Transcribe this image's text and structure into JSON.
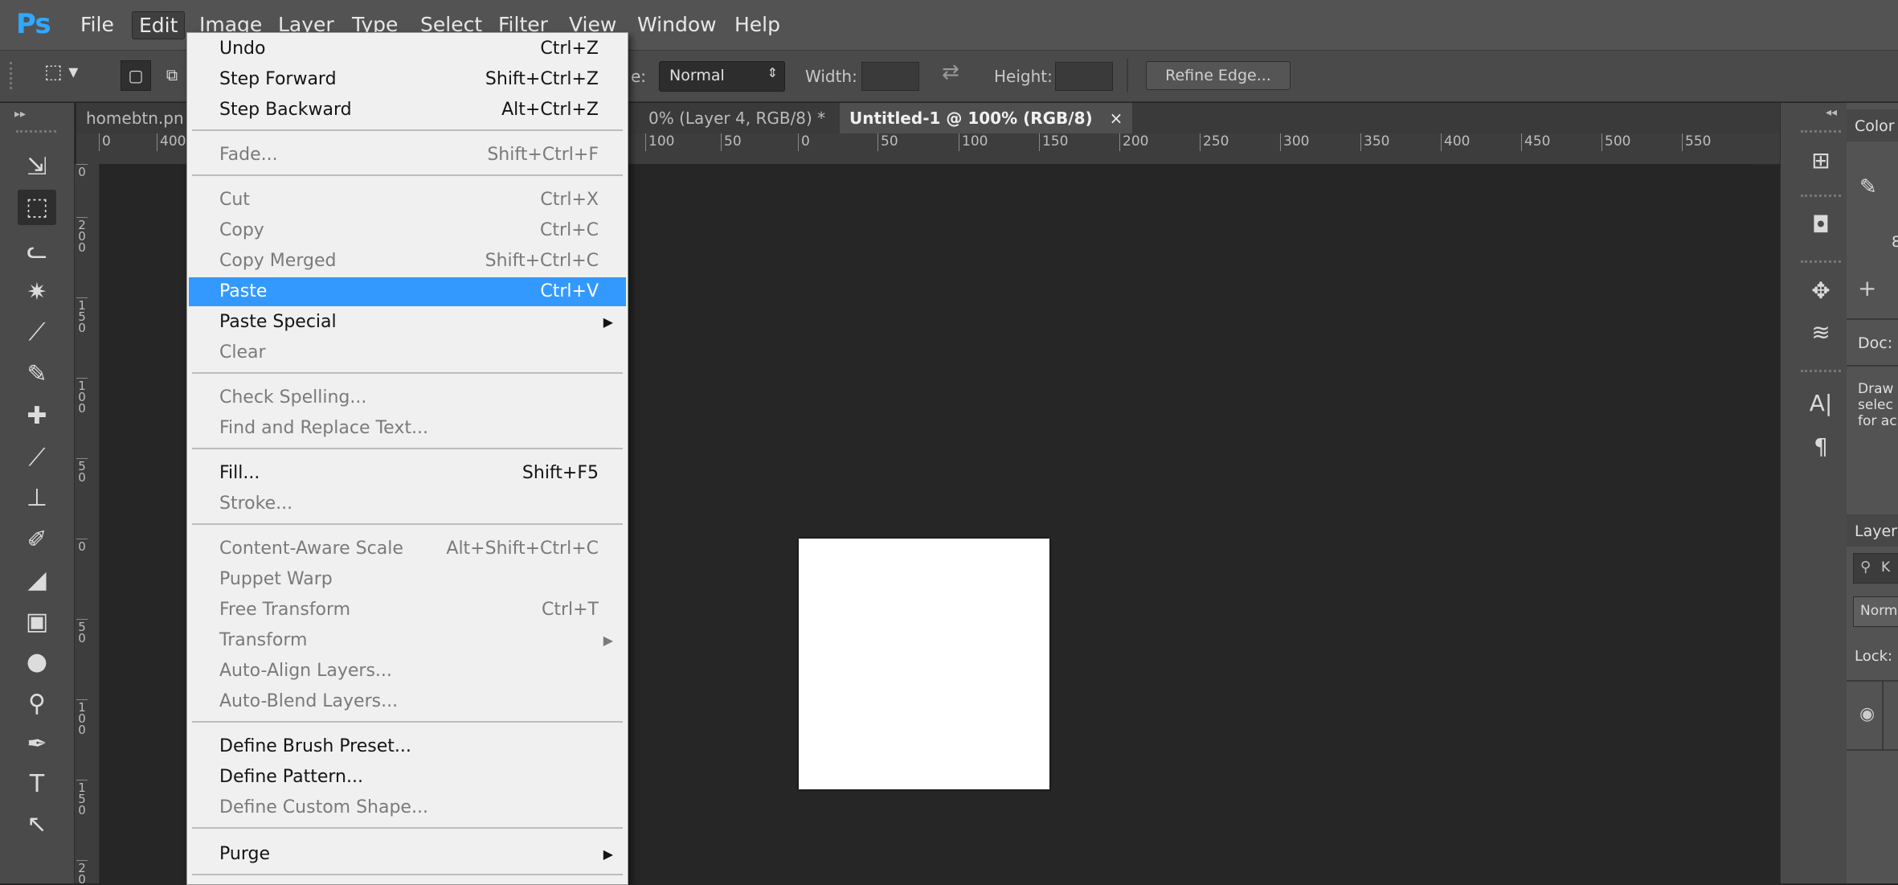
{
  "app": {
    "logo": "Ps"
  },
  "menubar": {
    "items": [
      {
        "label": "File"
      },
      {
        "label": "Edit"
      },
      {
        "label": "Image"
      },
      {
        "label": "Layer"
      },
      {
        "label": "Type"
      },
      {
        "label": "Select"
      },
      {
        "label": "Filter"
      },
      {
        "label": "View"
      },
      {
        "label": "Window"
      },
      {
        "label": "Help"
      }
    ]
  },
  "options": {
    "style_label": "e:",
    "style_value": "Normal",
    "width_label": "Width:",
    "height_label": "Height:",
    "refine_edge": "Refine Edge..."
  },
  "tabs": [
    {
      "label": "homebtn.pn"
    },
    {
      "label": "0% (Layer 4, RGB/8) *",
      "close": "×"
    },
    {
      "label": "Untitled-1 @ 100% (RGB/8)",
      "close": "×"
    }
  ],
  "ruler_h": {
    "left_labels": [
      "0",
      "400"
    ],
    "right_labels": [
      "100",
      "50",
      "0",
      "50",
      "100",
      "150",
      "200",
      "250",
      "300",
      "350",
      "400",
      "450",
      "500",
      "550"
    ]
  },
  "ruler_v": [
    "0",
    "2 0 0",
    "1 5 0",
    "1 0 0",
    "5 0",
    "0",
    "5 0",
    "1 0 0",
    "1 5 0",
    "2 0"
  ],
  "right_panel": {
    "color": "Color",
    "eight": "8",
    "doc": "Doc:",
    "hint_lines": [
      "Draw",
      "selec",
      "for ac"
    ],
    "layers": "Layers",
    "search": "K",
    "blend": "Norm",
    "lock": "Lock:"
  },
  "edit_menu": {
    "groups": [
      [
        {
          "label": "Undo",
          "shortcut": "Ctrl+Z",
          "enabled": true
        },
        {
          "label": "Step Forward",
          "shortcut": "Shift+Ctrl+Z",
          "enabled": true
        },
        {
          "label": "Step Backward",
          "shortcut": "Alt+Ctrl+Z",
          "enabled": true
        }
      ],
      [
        {
          "label": "Fade...",
          "shortcut": "Shift+Ctrl+F",
          "enabled": false
        }
      ],
      [
        {
          "label": "Cut",
          "shortcut": "Ctrl+X",
          "enabled": false
        },
        {
          "label": "Copy",
          "shortcut": "Ctrl+C",
          "enabled": false
        },
        {
          "label": "Copy Merged",
          "shortcut": "Shift+Ctrl+C",
          "enabled": false
        },
        {
          "label": "Paste",
          "shortcut": "Ctrl+V",
          "enabled": true,
          "highlight": true
        },
        {
          "label": "Paste Special",
          "shortcut": "",
          "enabled": true,
          "submenu": true
        },
        {
          "label": "Clear",
          "shortcut": "",
          "enabled": false
        }
      ],
      [
        {
          "label": "Check Spelling...",
          "shortcut": "",
          "enabled": false
        },
        {
          "label": "Find and Replace Text...",
          "shortcut": "",
          "enabled": false
        }
      ],
      [
        {
          "label": "Fill...",
          "shortcut": "Shift+F5",
          "enabled": true
        },
        {
          "label": "Stroke...",
          "shortcut": "",
          "enabled": false
        }
      ],
      [
        {
          "label": "Content-Aware Scale",
          "shortcut": "Alt+Shift+Ctrl+C",
          "enabled": false
        },
        {
          "label": "Puppet Warp",
          "shortcut": "",
          "enabled": false
        },
        {
          "label": "Free Transform",
          "shortcut": "Ctrl+T",
          "enabled": false
        },
        {
          "label": "Transform",
          "shortcut": "",
          "enabled": false,
          "submenu": true
        },
        {
          "label": "Auto-Align Layers...",
          "shortcut": "",
          "enabled": false
        },
        {
          "label": "Auto-Blend Layers...",
          "shortcut": "",
          "enabled": false
        }
      ],
      [
        {
          "label": "Define Brush Preset...",
          "shortcut": "",
          "enabled": true
        },
        {
          "label": "Define Pattern...",
          "shortcut": "",
          "enabled": true
        },
        {
          "label": "Define Custom Shape...",
          "shortcut": "",
          "enabled": false
        }
      ],
      [
        {
          "label": "Purge",
          "shortcut": "",
          "enabled": true,
          "submenu": true
        }
      ]
    ]
  }
}
